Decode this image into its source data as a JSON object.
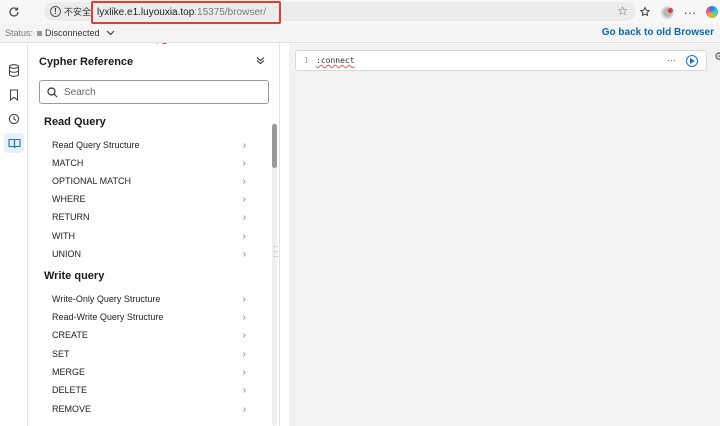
{
  "browser": {
    "security_label": "不安全",
    "url_host": "lyxlike.e1.luyouxia.top",
    "url_path": ":15375/browser/"
  },
  "status": {
    "label": "Status:",
    "value": "Disconnected",
    "old_browser_link": "Go back to old Browser"
  },
  "sidebar": {
    "title": "Cypher Reference",
    "search_placeholder": "Search",
    "sections": [
      {
        "title": "Read Query",
        "items": [
          "Read Query Structure",
          "MATCH",
          "OPTIONAL MATCH",
          "WHERE",
          "RETURN",
          "WITH",
          "UNION"
        ]
      },
      {
        "title": "Write query",
        "items": [
          "Write-Only Query Structure",
          "Read-Write Query Structure",
          "CREATE",
          "SET",
          "MERGE",
          "DELETE",
          "REMOVE"
        ]
      }
    ]
  },
  "editor": {
    "line_number": "1",
    "command": ":connect",
    "more": "···"
  },
  "colors": {
    "link": "#0a6aa9",
    "annotation_red": "#e53935",
    "run_blue": "#1a73c8"
  },
  "icons": {
    "rail": [
      "database-icon",
      "bookmark-icon",
      "history-icon",
      "book-icon"
    ]
  }
}
